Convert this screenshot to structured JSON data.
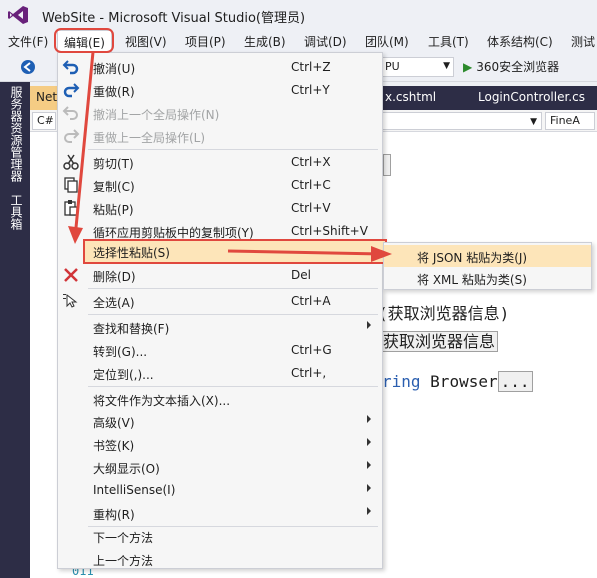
{
  "window": {
    "title": "WebSite - Microsoft Visual Studio(管理员)"
  },
  "menubar": [
    {
      "label": "文件(F)"
    },
    {
      "label": "编辑(E)"
    },
    {
      "label": "视图(V)"
    },
    {
      "label": "项目(P)"
    },
    {
      "label": "生成(B)"
    },
    {
      "label": "调试(D)"
    },
    {
      "label": "团队(M)"
    },
    {
      "label": "工具(T)"
    },
    {
      "label": "体系结构(C)"
    },
    {
      "label": "测试"
    }
  ],
  "toolbar": {
    "platform_value": "PU",
    "run_label": "360安全浏览器"
  },
  "left_strip": {
    "server_explorer": "服务器资源管理器",
    "toolbox": "工具箱"
  },
  "doc_tabs": [
    {
      "label": "Net"
    },
    {
      "label": "x.cshtml"
    },
    {
      "label": "LoginController.cs"
    }
  ],
  "navbar": {
    "left_combo": "C#",
    "right_combo": "FineA"
  },
  "code": {
    "line1": "(获取浏览器信息)",
    "line2": "获取浏览器信息",
    "line3_kw": "ring",
    "line3_name": "Browser",
    "line3_ellipsis": "...",
    "line_number": "011"
  },
  "edit_menu": {
    "undo": {
      "label": "撤消(U)",
      "shortcut": "Ctrl+Z"
    },
    "redo": {
      "label": "重做(R)",
      "shortcut": "Ctrl+Y"
    },
    "undo_global": {
      "label": "撤消上一个全局操作(N)"
    },
    "redo_global": {
      "label": "重做上一全局操作(L)"
    },
    "cut": {
      "label": "剪切(T)",
      "shortcut": "Ctrl+X"
    },
    "copy": {
      "label": "复制(C)",
      "shortcut": "Ctrl+C"
    },
    "paste": {
      "label": "粘贴(P)",
      "shortcut": "Ctrl+V"
    },
    "cycle_clipboard": {
      "label": "循环应用剪贴板中的复制项(Y)",
      "shortcut": "Ctrl+Shift+V"
    },
    "paste_special": {
      "label": "选择性粘贴(S)"
    },
    "delete": {
      "label": "删除(D)",
      "shortcut": "Del"
    },
    "select_all": {
      "label": "全选(A)",
      "shortcut": "Ctrl+A"
    },
    "find_replace": {
      "label": "查找和替换(F)"
    },
    "goto": {
      "label": "转到(G)...",
      "shortcut": "Ctrl+G"
    },
    "navigate_to": {
      "label": "定位到(,)...",
      "shortcut": "Ctrl+,"
    },
    "insert_file": {
      "label": "将文件作为文本插入(X)..."
    },
    "advanced": {
      "label": "高级(V)"
    },
    "bookmarks": {
      "label": "书签(K)"
    },
    "outlining": {
      "label": "大纲显示(O)"
    },
    "intellisense": {
      "label": "IntelliSense(I)"
    },
    "refactor": {
      "label": "重构(R)"
    },
    "next_method": {
      "label": "下一个方法"
    },
    "prev_method": {
      "label": "上一个方法"
    }
  },
  "paste_special_menu": [
    {
      "label": "将 JSON 粘贴为类(J)"
    },
    {
      "label": "将 XML 粘贴为类(S)"
    }
  ],
  "colors": {
    "highlight": "#fde5b9",
    "annotation_red": "#e0483e",
    "strip_dark": "#2d2d46",
    "active_tab": "#f5cc84"
  }
}
